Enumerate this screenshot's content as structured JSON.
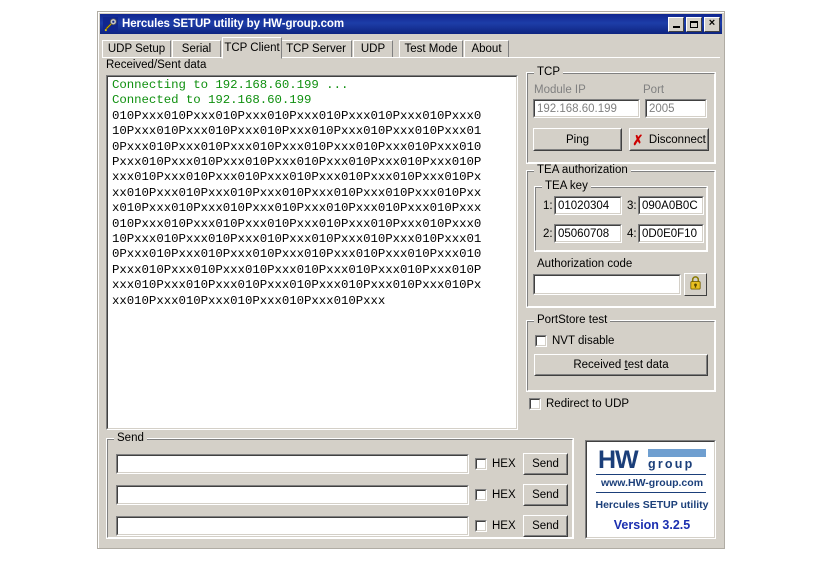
{
  "window": {
    "title": "Hercules SETUP utility by HW-group.com",
    "title_icon": "hercules-wrench-icon",
    "controls": {
      "minimize": "minimize-icon",
      "maximize": "maximize-icon",
      "close": "close-icon"
    }
  },
  "tabs": [
    {
      "label": "UDP Setup",
      "active": false
    },
    {
      "label": "Serial",
      "active": false
    },
    {
      "label": "TCP Client",
      "active": true
    },
    {
      "label": "TCP Server",
      "active": false
    },
    {
      "label": "UDP",
      "active": false
    },
    {
      "label": "Test Mode",
      "active": false
    },
    {
      "label": "About",
      "active": false
    }
  ],
  "received": {
    "label": "Received/Sent data",
    "connecting_line": "Connecting to 192.168.60.199 ...",
    "connected_line": "Connected to 192.168.60.199",
    "data_lines": [
      "010Pxxx010Pxxx010Pxxx010Pxxx010Pxxx010Pxxx010Pxxx0",
      "10Pxxx010Pxxx010Pxxx010Pxxx010Pxxx010Pxxx010Pxxx01",
      "0Pxxx010Pxxx010Pxxx010Pxxx010Pxxx010Pxxx010Pxxx010",
      "Pxxx010Pxxx010Pxxx010Pxxx010Pxxx010Pxxx010Pxxx010P",
      "xxx010Pxxx010Pxxx010Pxxx010Pxxx010Pxxx010Pxxx010Px",
      "xx010Pxxx010Pxxx010Pxxx010Pxxx010Pxxx010Pxxx010Pxx",
      "x010Pxxx010Pxxx010Pxxx010Pxxx010Pxxx010Pxxx010Pxxx",
      "010Pxxx010Pxxx010Pxxx010Pxxx010Pxxx010Pxxx010Pxxx0",
      "10Pxxx010Pxxx010Pxxx010Pxxx010Pxxx010Pxxx010Pxxx01",
      "0Pxxx010Pxxx010Pxxx010Pxxx010Pxxx010Pxxx010Pxxx010",
      "Pxxx010Pxxx010Pxxx010Pxxx010Pxxx010Pxxx010Pxxx010P",
      "xxx010Pxxx010Pxxx010Pxxx010Pxxx010Pxxx010Pxxx010Px",
      "xx010Pxxx010Pxxx010Pxxx010Pxxx010Pxxx"
    ]
  },
  "tcp": {
    "group_label": "TCP",
    "module_ip_label": "Module IP",
    "module_ip_value": "192.168.60.199",
    "port_label": "Port",
    "port_value": "2005",
    "ping_button": "Ping",
    "disconnect_button": "Disconnect",
    "disconnect_icon": "red-x-icon"
  },
  "tea": {
    "group_label": "TEA authorization",
    "key_group_label": "TEA key",
    "keys": [
      {
        "num": "1:",
        "value": "01020304"
      },
      {
        "num": "2:",
        "value": "05060708"
      },
      {
        "num": "3:",
        "value": "090A0B0C"
      },
      {
        "num": "4:",
        "value": "0D0E0F10"
      }
    ],
    "auth_code_label": "Authorization code",
    "auth_code_value": "",
    "lock_icon": "padlock-icon"
  },
  "portstore": {
    "group_label": "PortStore test",
    "nvt_disable_label": "NVT disable",
    "nvt_disable_checked": false,
    "received_test_data_pre": "Received ",
    "received_test_data_acc": "t",
    "received_test_data_post": "est data"
  },
  "redirect": {
    "label": "Redirect to UDP",
    "checked": false
  },
  "send": {
    "group_label": "Send",
    "rows": [
      {
        "value": "",
        "hex_label": "HEX",
        "hex_checked": false,
        "send_label": "Send"
      },
      {
        "value": "",
        "hex_label": "HEX",
        "hex_checked": false,
        "send_label": "Send"
      },
      {
        "value": "",
        "hex_label": "HEX",
        "hex_checked": false,
        "send_label": "Send"
      }
    ]
  },
  "logo": {
    "hw": "HW",
    "group_word": "group",
    "url": "www.HW-group.com",
    "product": "Hercules SETUP utility",
    "version": "Version  3.2.5"
  },
  "colors": {
    "title_bar": "#10268f",
    "face": "#d4d0c8",
    "connection_text": "#109010",
    "brand_blue": "#1b3f7a",
    "version_blue": "#1b2fb0",
    "accent_red": "#cc0000"
  }
}
